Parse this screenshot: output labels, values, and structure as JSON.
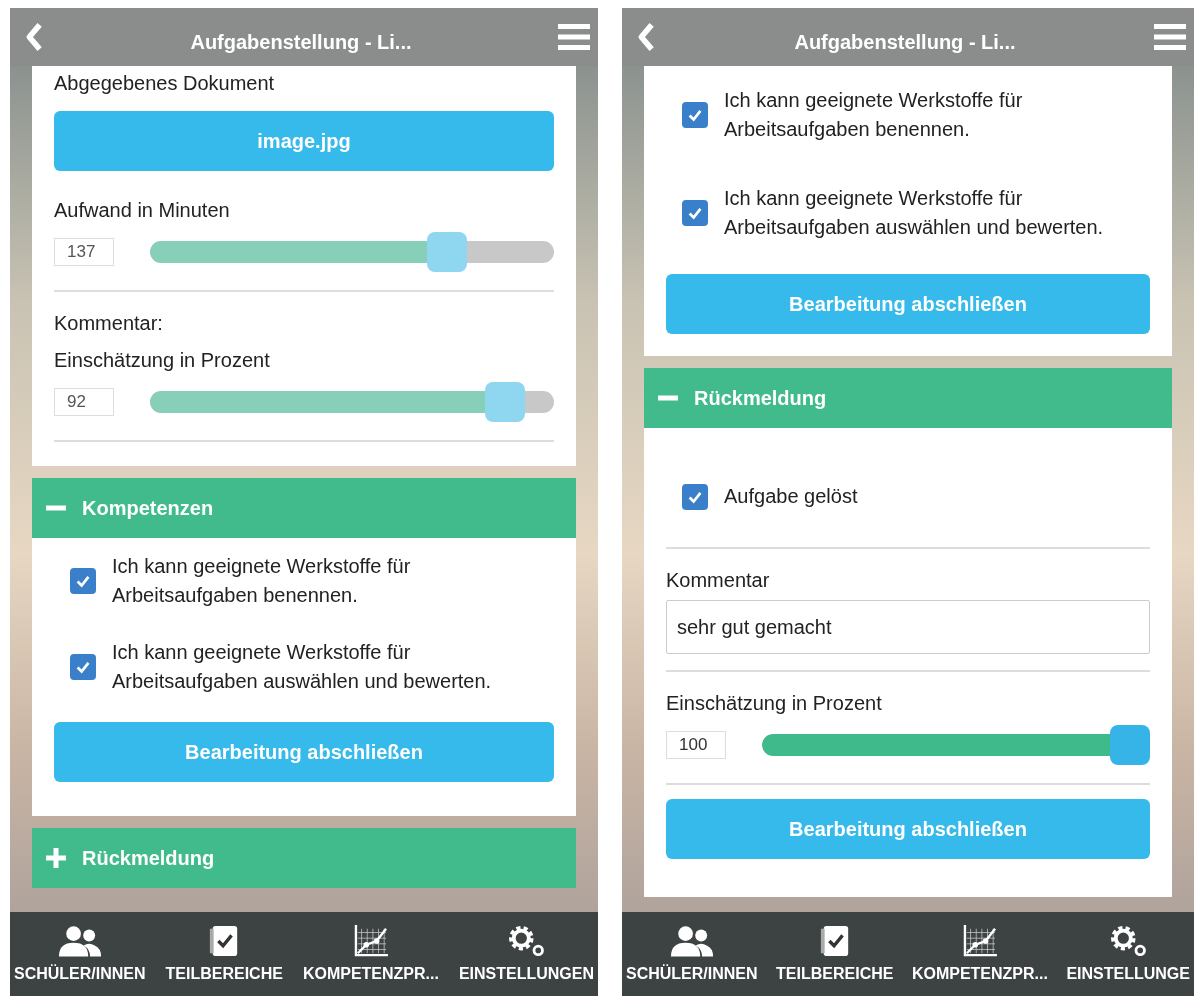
{
  "screens": [
    {
      "top_bar": {
        "title": "Aufgabenstellung - Li..."
      },
      "panels": [
        {
          "kind": "card",
          "items": [
            {
              "kind": "label",
              "text": "Abgegebenes Dokument"
            },
            {
              "kind": "file_button",
              "text": "image.jpg"
            },
            {
              "kind": "slider",
              "label": "Aufwand in Minuten",
              "value": "137",
              "level": 0.76,
              "disabled": true
            },
            {
              "kind": "divider"
            },
            {
              "kind": "label",
              "text": "Kommentar:"
            },
            {
              "kind": "slider",
              "label": "Einschätzung in Prozent",
              "value": "92",
              "level": 0.92,
              "disabled": true
            },
            {
              "kind": "divider"
            }
          ]
        },
        {
          "kind": "accordion",
          "title": "Kompetenzen",
          "expanded": true,
          "items": [
            {
              "kind": "checkbox",
              "text": "Ich kann geeignete Werkstoffe für Arbeitsaufgaben benennen.",
              "checked": true
            },
            {
              "kind": "checkbox",
              "text": "Ich kann geeignete Werkstoffe für Arbeitsaufgaben auswählen und bewerten.",
              "checked": true
            },
            {
              "kind": "button",
              "text": "Bearbeitung abschließen"
            }
          ]
        },
        {
          "kind": "accordion",
          "title": "Rückmeldung",
          "expanded": false
        }
      ],
      "nav": [
        {
          "label": "SCHÜLER/INNEN"
        },
        {
          "label": "TEILBEREICHE"
        },
        {
          "label": "KOMPETENZPR..."
        },
        {
          "label": "EINSTELLUNGEN"
        }
      ]
    },
    {
      "top_bar": {
        "title": "Aufgabenstellung - Li..."
      },
      "panels": [
        {
          "kind": "card",
          "items": [
            {
              "kind": "checkbox",
              "text": "Ich kann geeignete Werkstoffe für Arbeitsaufgaben benennen.",
              "checked": true
            },
            {
              "kind": "checkbox",
              "text": "Ich kann geeignete Werkstoffe für Arbeitsaufgaben auswählen und bewerten.",
              "checked": true
            },
            {
              "kind": "button",
              "text": "Bearbeitung abschließen"
            }
          ]
        },
        {
          "kind": "accordion",
          "title": "Rückmeldung",
          "expanded": true,
          "items": [
            {
              "kind": "checkbox",
              "text": "Aufgabe gelöst",
              "checked": true
            },
            {
              "kind": "divider"
            },
            {
              "kind": "text_field",
              "label": "Kommentar",
              "value": "sehr gut gemacht"
            },
            {
              "kind": "divider"
            },
            {
              "kind": "slider",
              "label": "Einschätzung in Prozent",
              "value": "100",
              "level": 1,
              "disabled": false
            },
            {
              "kind": "divider"
            },
            {
              "kind": "button",
              "text": "Bearbeitung abschließen"
            }
          ]
        }
      ],
      "nav": [
        {
          "label": "SCHÜLER/INNEN"
        },
        {
          "label": "TEILBEREICHE"
        },
        {
          "label": "KOMPETENZPR..."
        },
        {
          "label": "EINSTELLUNGE"
        }
      ]
    }
  ]
}
